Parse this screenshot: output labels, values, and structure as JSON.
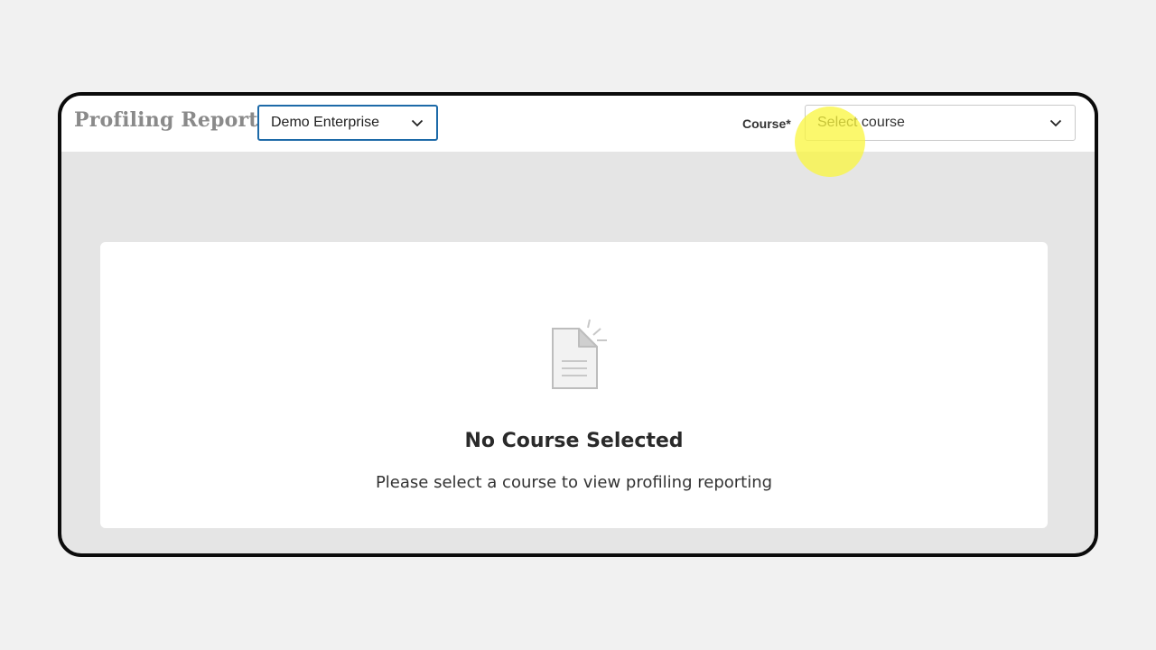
{
  "header": {
    "title": "Profiling Report",
    "enterprise_select": {
      "value": "Demo Enterprise"
    },
    "course_label": "Course*",
    "course_select": {
      "placeholder": "Select course"
    }
  },
  "empty_state": {
    "icon": "document-icon",
    "title": "No Course Selected",
    "message": "Please select a course to view profiling reporting"
  },
  "colors": {
    "accent": "#1d6aa8",
    "page_bg": "#f1f1f1",
    "content_bg": "#e5e5e5",
    "cursor_highlight": "#f7f03a"
  }
}
